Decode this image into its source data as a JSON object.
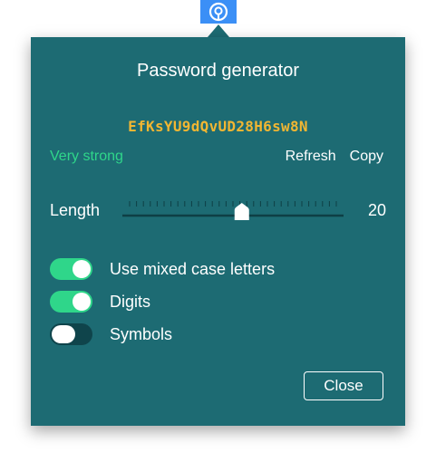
{
  "anchor": {
    "icon": "key-icon",
    "color": "#3b8ff6"
  },
  "panel": {
    "title": "Password generator",
    "background_color": "#1d6b73",
    "password": "EfKsYU9dQvUD28H6sw8N",
    "password_color": "#f2b632",
    "strength": "Very strong",
    "strength_color": "#2fd68a",
    "refresh_label": "Refresh",
    "copy_label": "Copy",
    "length_label": "Length",
    "length_value": "20",
    "length_slider_fraction": 0.54,
    "options": [
      {
        "label": "Use mixed case letters",
        "enabled": true
      },
      {
        "label": "Digits",
        "enabled": true
      },
      {
        "label": "Symbols",
        "enabled": false
      }
    ],
    "close_label": "Close"
  }
}
